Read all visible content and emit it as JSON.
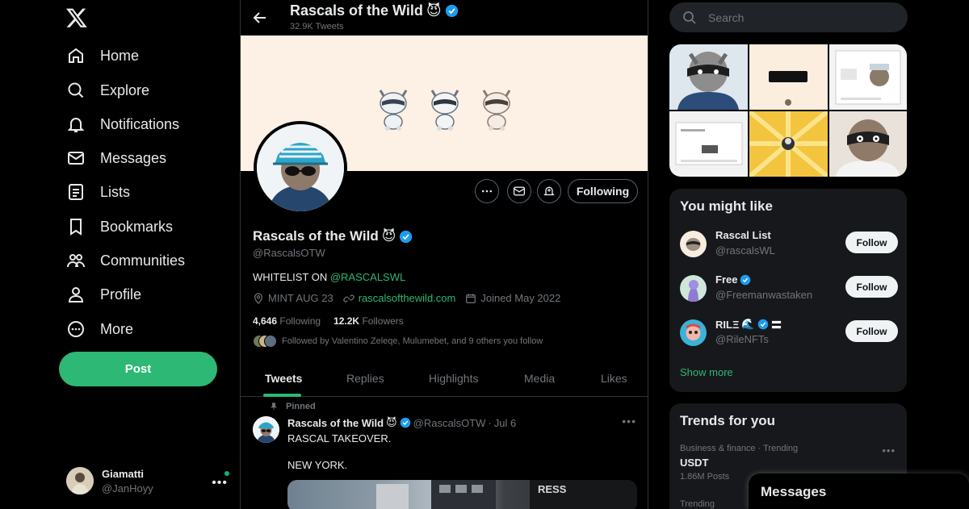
{
  "nav": {
    "items": [
      {
        "label": "Home",
        "icon": "home-icon"
      },
      {
        "label": "Explore",
        "icon": "search-icon"
      },
      {
        "label": "Notifications",
        "icon": "bell-icon"
      },
      {
        "label": "Messages",
        "icon": "envelope-icon"
      },
      {
        "label": "Lists",
        "icon": "list-icon"
      },
      {
        "label": "Bookmarks",
        "icon": "bookmark-icon"
      },
      {
        "label": "Communities",
        "icon": "people-icon"
      },
      {
        "label": "Profile",
        "icon": "person-icon"
      },
      {
        "label": "More",
        "icon": "more-circle-icon"
      }
    ],
    "post_label": "Post",
    "account": {
      "name": "Giamatti",
      "handle": "@JanHoyy"
    }
  },
  "header": {
    "title": "Rascals of the Wild",
    "emoji": "😈",
    "tweet_count": "32.9K Tweets"
  },
  "profile": {
    "name": "Rascals of the Wild",
    "emoji": "😈",
    "handle": "@RascalsOTW",
    "bio_prefix": "WHITELIST ON ",
    "bio_link": "@RASCALSWL",
    "location": "MINT AUG 23",
    "website": "rascalsofthewild.com",
    "joined": "Joined May 2022",
    "following_count": "4,646",
    "following_label": "Following",
    "followers_count": "12.2K",
    "followers_label": "Followers",
    "followed_by": "Followed by Valentino Zeleqe, Mulumebet, and 9 others you follow",
    "following_button": "Following"
  },
  "tabs": [
    "Tweets",
    "Replies",
    "Highlights",
    "Media",
    "Likes"
  ],
  "active_tab": "Tweets",
  "tweet": {
    "pinned_label": "Pinned",
    "author": "Rascals of the Wild",
    "emoji": "😈",
    "handle": "@RascalsOTW",
    "sep": "·",
    "date": "Jul 6",
    "line1": "RASCAL TAKEOVER.",
    "line2": "NEW YORK."
  },
  "search": {
    "placeholder": "Search"
  },
  "you_might_like": {
    "title": "You might like",
    "suggestions": [
      {
        "name": "Rascal List",
        "handle": "@rascalsWL",
        "verified": false,
        "extra": ""
      },
      {
        "name": "Free",
        "handle": "@Freemanwastaken",
        "verified": true,
        "extra": ""
      },
      {
        "name": "RILΞ",
        "handle": "@RileNFTs",
        "verified": true,
        "extra": "🌊"
      }
    ],
    "follow_label": "Follow",
    "show_more": "Show more"
  },
  "trends": {
    "title": "Trends for you",
    "items": [
      {
        "meta": "Business & finance · Trending",
        "name": "USDT",
        "posts": "1.86M Posts"
      },
      {
        "meta": "Trending",
        "name": "",
        "posts": ""
      }
    ]
  },
  "messages_drawer": {
    "title": "Messages"
  },
  "colors": {
    "accent": "#2db875",
    "verified": "#1d9bf0",
    "background": "#000000",
    "card": "#16181c"
  }
}
